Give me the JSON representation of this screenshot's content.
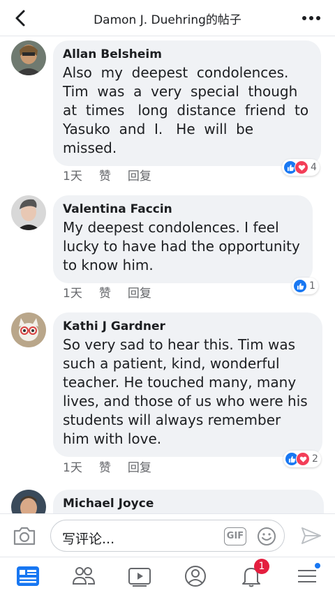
{
  "header": {
    "title": "Damon J. Duehring的帖子",
    "back_icon": "chevron-left-icon",
    "more_icon": "more-horizontal-icon"
  },
  "comments": [
    {
      "author": "Allan Belsheim",
      "text_lines": [
        "Also  my  deepest  condolences.",
        "Tim  was  a  very  special  though",
        "at  times   long  distance  friend  to",
        "Yasuko  and  I.   He  will  be",
        "missed."
      ],
      "time": "1天",
      "like_label": "赞",
      "reply_label": "回复",
      "reactions": [
        "like",
        "love"
      ],
      "reaction_count": "4"
    },
    {
      "author": "Valentina Faccin",
      "text_lines": [
        "My deepest condolences. I feel",
        "lucky to have had the opportunity",
        "to know him."
      ],
      "time": "1天",
      "like_label": "赞",
      "reply_label": "回复",
      "reactions": [
        "like"
      ],
      "reaction_count": "1"
    },
    {
      "author": "Kathi J Gardner",
      "text_lines": [
        "So very sad to hear this. Tim was",
        "such a patient, kind, wonderful",
        "teacher. He touched many, many",
        "lives, and those of us who were his",
        "students will always remember",
        "him with love."
      ],
      "time": "1天",
      "like_label": "赞",
      "reply_label": "回复",
      "reactions": [
        "like",
        "love"
      ],
      "reaction_count": "2"
    },
    {
      "author": "Michael Joyce",
      "text_lines": []
    }
  ],
  "composer": {
    "placeholder": "写评论...",
    "gif_label": "GIF",
    "camera_icon": "camera-icon",
    "emoji_icon": "smiley-icon",
    "send_icon": "send-icon"
  },
  "nav": {
    "items": [
      "news-feed-icon",
      "friends-icon",
      "watch-icon",
      "profile-icon",
      "notifications-icon",
      "menu-icon"
    ],
    "notification_badge": "1"
  },
  "colors": {
    "bubble": "#f0f2f5",
    "like": "#1877f2",
    "love": "#f33e58",
    "badge": "#e41e3f"
  }
}
